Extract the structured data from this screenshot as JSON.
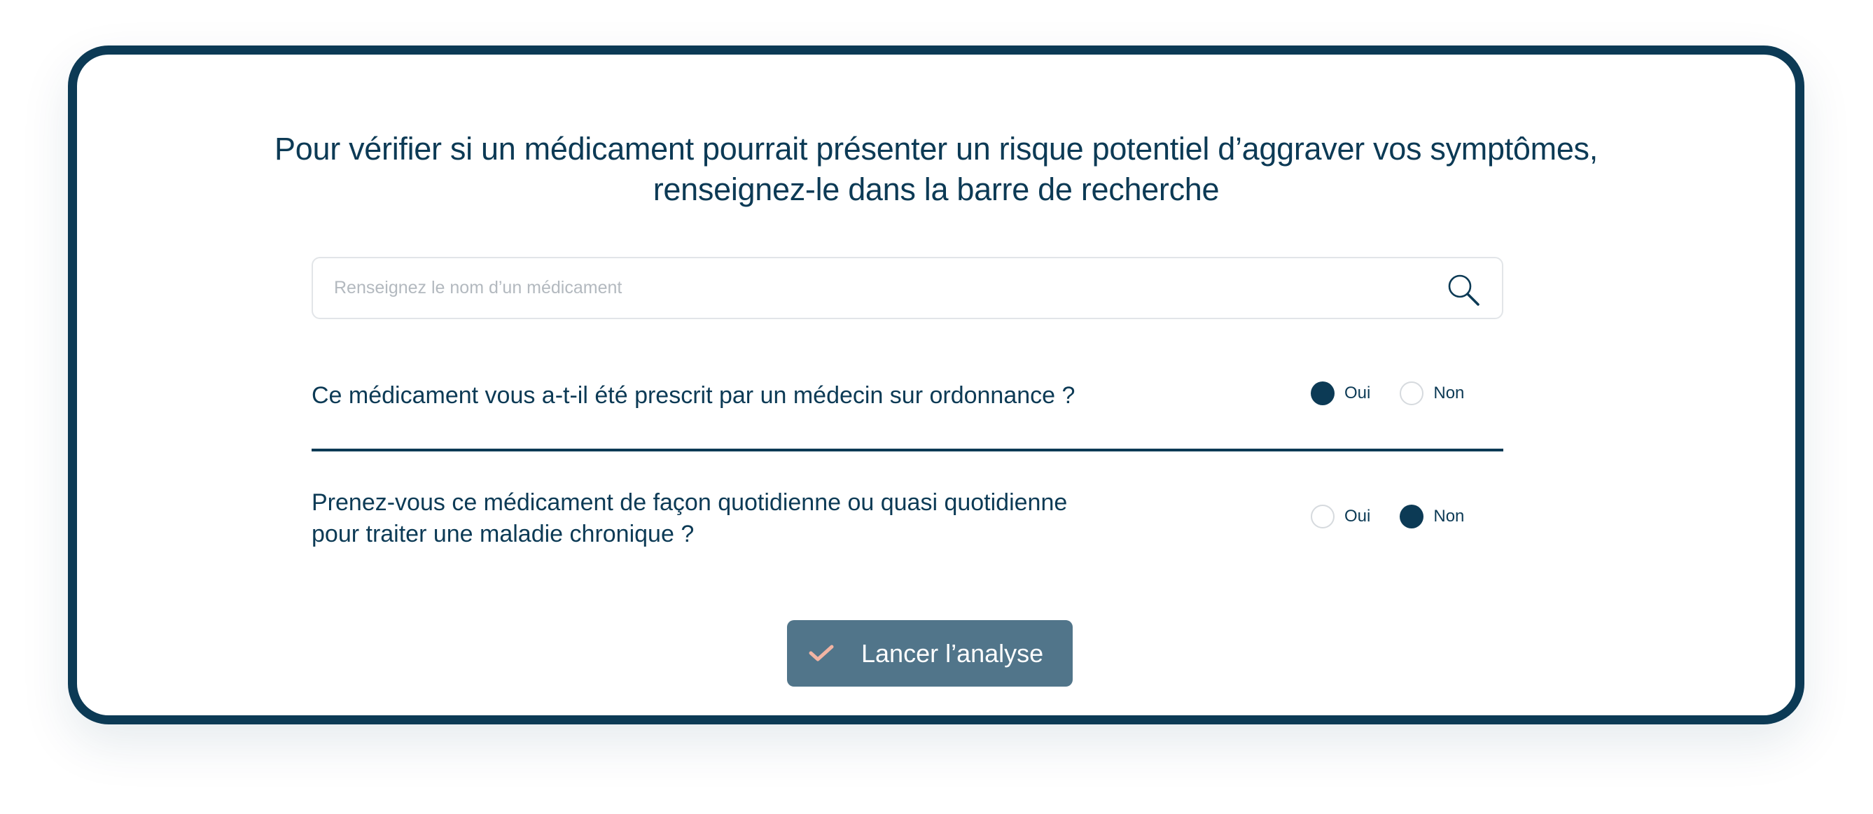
{
  "header": {
    "title_line1": "Pour vérifier si un médicament pourrait présenter un risque potentiel d’aggraver vos symptômes,",
    "title_line2": "renseignez-le dans la barre de recherche"
  },
  "search": {
    "placeholder": "Renseignez le nom d’un médicament",
    "value": "",
    "icon": "search-icon"
  },
  "questions": [
    {
      "text": "Ce médicament vous a-t-il été prescrit par un médecin sur ordonnance ?",
      "options": [
        {
          "label": "Oui",
          "selected": true
        },
        {
          "label": "Non",
          "selected": false
        }
      ]
    },
    {
      "text_line1": "Prenez-vous ce médicament de façon quotidienne ou quasi quotidienne",
      "text_line2": "pour traiter une maladie chronique ?",
      "options": [
        {
          "label": "Oui",
          "selected": false
        },
        {
          "label": "Non",
          "selected": true
        }
      ]
    }
  ],
  "submit": {
    "label": "Lancer l’analyse",
    "icon": "check-icon"
  },
  "colors": {
    "primary": "#0c3a55",
    "button_bg": "#51758a",
    "check_accent": "#f2b4a3",
    "radio_border": "#d6dade",
    "input_border": "#e2e5e8",
    "placeholder": "#b3b9bf"
  }
}
